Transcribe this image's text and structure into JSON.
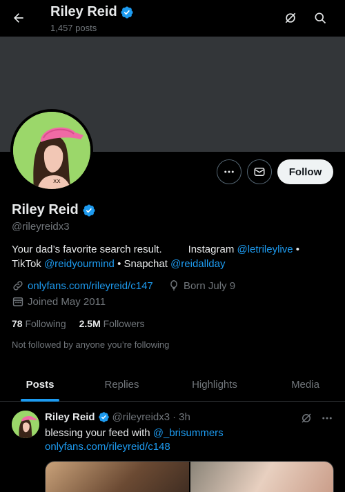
{
  "header": {
    "title": "Riley Reid",
    "post_count": "1,457 posts"
  },
  "profile": {
    "name": "Riley Reid",
    "handle": "@rileyreidx3",
    "follow_label": "Follow",
    "bio": {
      "text1": "Your dad’s favorite search result.",
      "instagram_label": "Instagram",
      "instagram_handle": "@letrileylive",
      "sep1": "•",
      "tiktok_label": "TikTok",
      "tiktok_handle": "@reidyourmind",
      "sep2": "•",
      "snapchat_label": "Snapchat",
      "snapchat_handle": "@reidallday"
    },
    "website": "onlyfans.com/rileyreid/c147",
    "birthday": "Born July 9",
    "joined": "Joined May 2011",
    "following_count": "78",
    "following_label": "Following",
    "followers_count": "2.5M",
    "followers_label": "Followers",
    "not_followed": "Not followed by anyone you’re following"
  },
  "tabs": [
    {
      "label": "Posts",
      "active": true
    },
    {
      "label": "Replies",
      "active": false
    },
    {
      "label": "Highlights",
      "active": false
    },
    {
      "label": "Media",
      "active": false
    }
  ],
  "post": {
    "name": "Riley Reid",
    "handle": "@rileyreidx3",
    "dot": "·",
    "time": "3h",
    "text": "blessing your feed with",
    "mention": "@_brisummers",
    "link": "onlyfans.com/rileyreid/c148"
  },
  "colors": {
    "accent": "#1d9bf0",
    "verified": "#1d9bf0",
    "banner": "#333639",
    "avatar_bg": "#9bd76a"
  }
}
